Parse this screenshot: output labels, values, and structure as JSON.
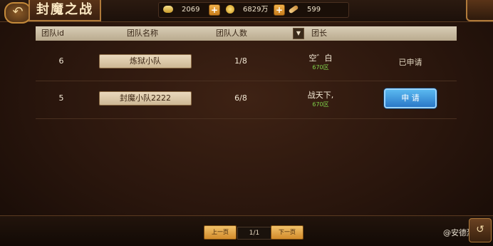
{
  "header": {
    "title": "封魔之战",
    "back_icon": "back-arrow-icon",
    "resources": [
      {
        "icon": "ingot-icon",
        "value": "2069"
      },
      {
        "icon": "gold-coin-icon",
        "value": "6829万"
      },
      {
        "icon": "feather-icon",
        "value": "599"
      }
    ]
  },
  "table": {
    "columns": [
      "团队id",
      "团队名称",
      "团队人数",
      "团长"
    ],
    "rows": [
      {
        "id": "6",
        "name": "炼狱小队",
        "members": "1/8",
        "leader": "空゛白",
        "zone": "670区",
        "action": "已申请"
      },
      {
        "id": "5",
        "name": "封魔小队2222",
        "members": "6/8",
        "leader": "战天下,",
        "zone": "670区",
        "action": "申 请"
      }
    ]
  },
  "pagination": {
    "prev_label": "上一页",
    "page": "1/1",
    "next_label": "下一页"
  },
  "watermark": "@安德烈",
  "colors": {
    "accent": "#d18a2a",
    "apply_button": "#2a78c8",
    "zone_text": "#7fd24a"
  }
}
